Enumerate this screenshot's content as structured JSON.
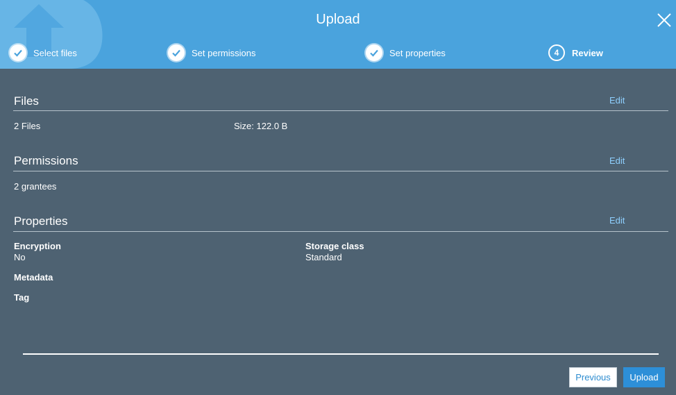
{
  "dialog": {
    "title": "Upload",
    "close_icon": "close-icon",
    "logo_icon": "upload-bucket-logo"
  },
  "steps": [
    {
      "label": "Select files",
      "state": "done",
      "icon": "check-icon"
    },
    {
      "label": "Set permissions",
      "state": "done",
      "icon": "check-icon"
    },
    {
      "label": "Set properties",
      "state": "done",
      "icon": "check-icon"
    },
    {
      "label": "Review",
      "state": "current",
      "number": "4"
    }
  ],
  "files": {
    "title": "Files",
    "edit_label": "Edit",
    "count": "2 Files",
    "size": "Size: 122.0 B"
  },
  "permissions": {
    "title": "Permissions",
    "edit_label": "Edit",
    "grantees": "2 grantees"
  },
  "properties": {
    "title": "Properties",
    "edit_label": "Edit",
    "encryption_label": "Encryption",
    "encryption_value": "No",
    "storage_class_label": "Storage class",
    "storage_class_value": "Standard",
    "metadata_label": "Metadata",
    "tag_label": "Tag"
  },
  "footer": {
    "previous_label": "Previous",
    "upload_label": "Upload"
  },
  "colors": {
    "header_bg": "#4aa3dd",
    "body_bg": "#4e6272",
    "link": "#8ed0ff",
    "primary_button": "#2d8fd8"
  }
}
